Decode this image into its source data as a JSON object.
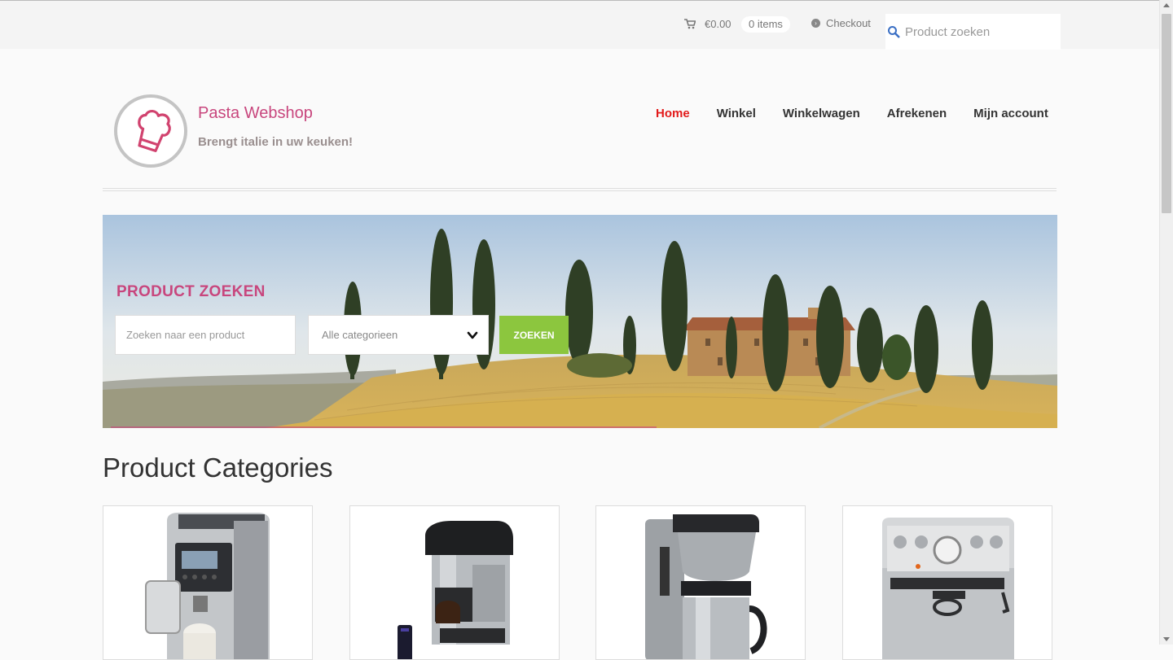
{
  "topbar": {
    "cart_total": "€0.00",
    "cart_count": "0 items",
    "checkout_label": "Checkout",
    "search_placeholder": "Product zoeken"
  },
  "header": {
    "site_title": "Pasta Webshop",
    "tagline": "Brengt italie in uw keuken!"
  },
  "nav": {
    "items": [
      {
        "label": "Home",
        "active": true
      },
      {
        "label": "Winkel"
      },
      {
        "label": "Winkelwagen"
      },
      {
        "label": "Afrekenen"
      },
      {
        "label": "Mijn account"
      }
    ]
  },
  "hero": {
    "heading": "PRODUCT ZOEKEN",
    "search_placeholder": "Zoeken naar een product",
    "category_selected": "Alle categorieen",
    "button_label": "ZOEKEN"
  },
  "categories": {
    "title": "Product Categories",
    "items": [
      {
        "icon": "espresso-machine-image"
      },
      {
        "icon": "capsule-machine-image"
      },
      {
        "icon": "filter-coffee-machine-image"
      },
      {
        "icon": "dual-boiler-espresso-image"
      }
    ]
  },
  "colors": {
    "accent_pink": "#c8467d",
    "nav_active": "#e21a1a",
    "button_green": "#8cc63e"
  }
}
